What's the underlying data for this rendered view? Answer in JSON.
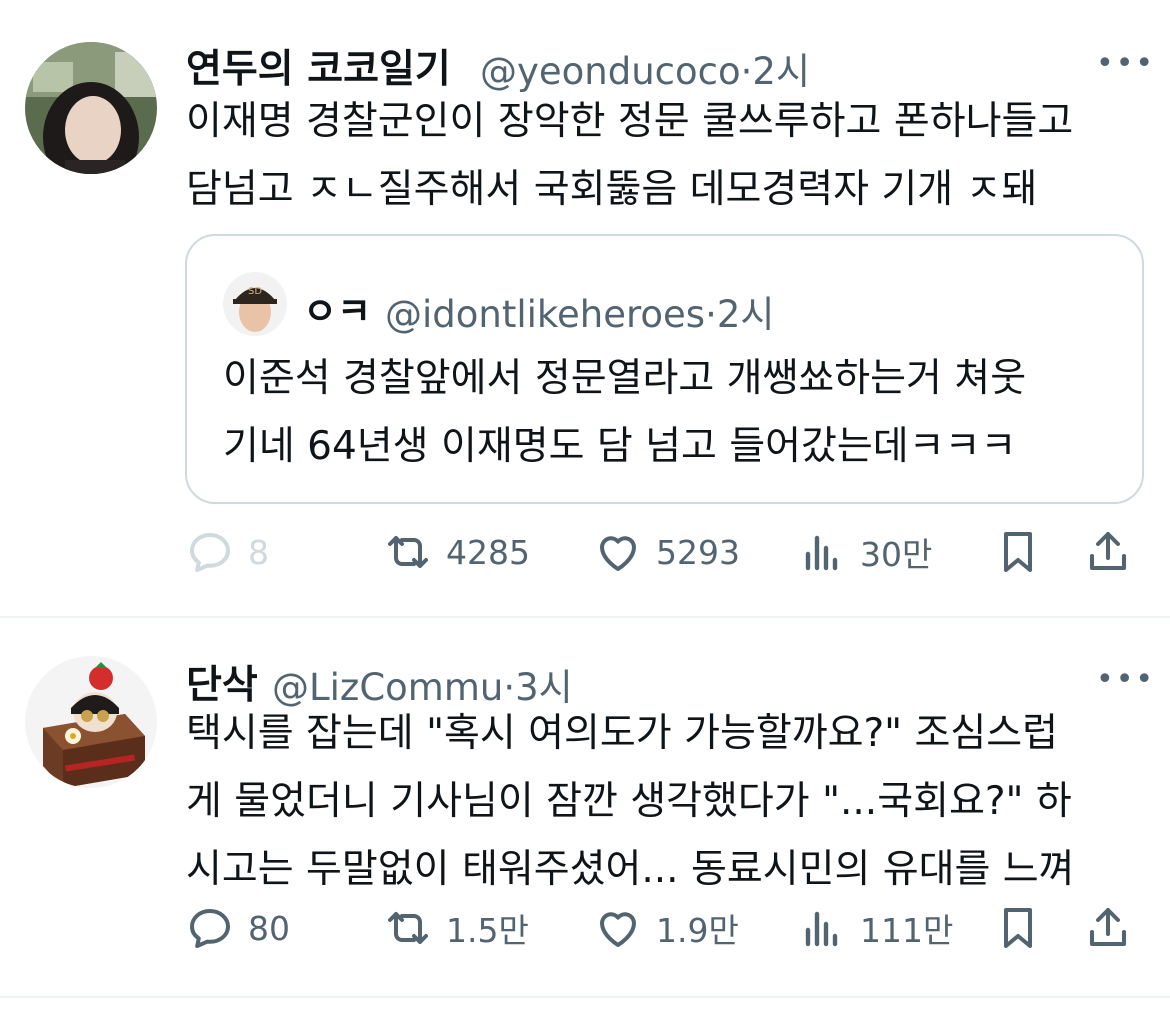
{
  "tweets": [
    {
      "author_name": "연두의 코코일기",
      "handle": "@yeonducoco",
      "time": "2시",
      "more_label": "•••",
      "text_lines": [
        "이재명 경찰군인이 장악한 정문 쿨쓰루하고 폰하나들고",
        "담넘고 ㅈㄴ질주해서 국회뚫음 데모경력자 기개 ㅈ돼"
      ],
      "quote": {
        "author_name": "ㅇㅋ",
        "handle": "@idontlikeheroes",
        "time": "2시",
        "text_lines": [
          "이준석 경찰앞에서 정문열라고 개쌩쑈하는거 쳐웃",
          "기네 64년생 이재명도 담 넘고 들어갔는데ㅋㅋㅋ"
        ]
      },
      "actions": {
        "replies": "8",
        "reposts": "4285",
        "likes": "5293",
        "views": "30만"
      }
    },
    {
      "author_name": "단삭",
      "handle": "@LizCommu",
      "time": "3시",
      "more_label": "•••",
      "text_lines": [
        "택시를 잡는데 \"혹시 여의도가 가능할까요?\" 조심스럽",
        "게 물었더니 기사님이 잠깐 생각했다가 \"...국회요?\" 하",
        "시고는 두말없이 태워주셨어... 동료시민의 유대를 느껴"
      ],
      "actions": {
        "replies": "80",
        "reposts": "1.5만",
        "likes": "1.9만",
        "views": "111만"
      }
    }
  ],
  "separator": "·",
  "colors": {
    "text": "#0f1419",
    "secondary": "#536471",
    "border": "#cfd9de",
    "divider": "#eff3f4"
  }
}
